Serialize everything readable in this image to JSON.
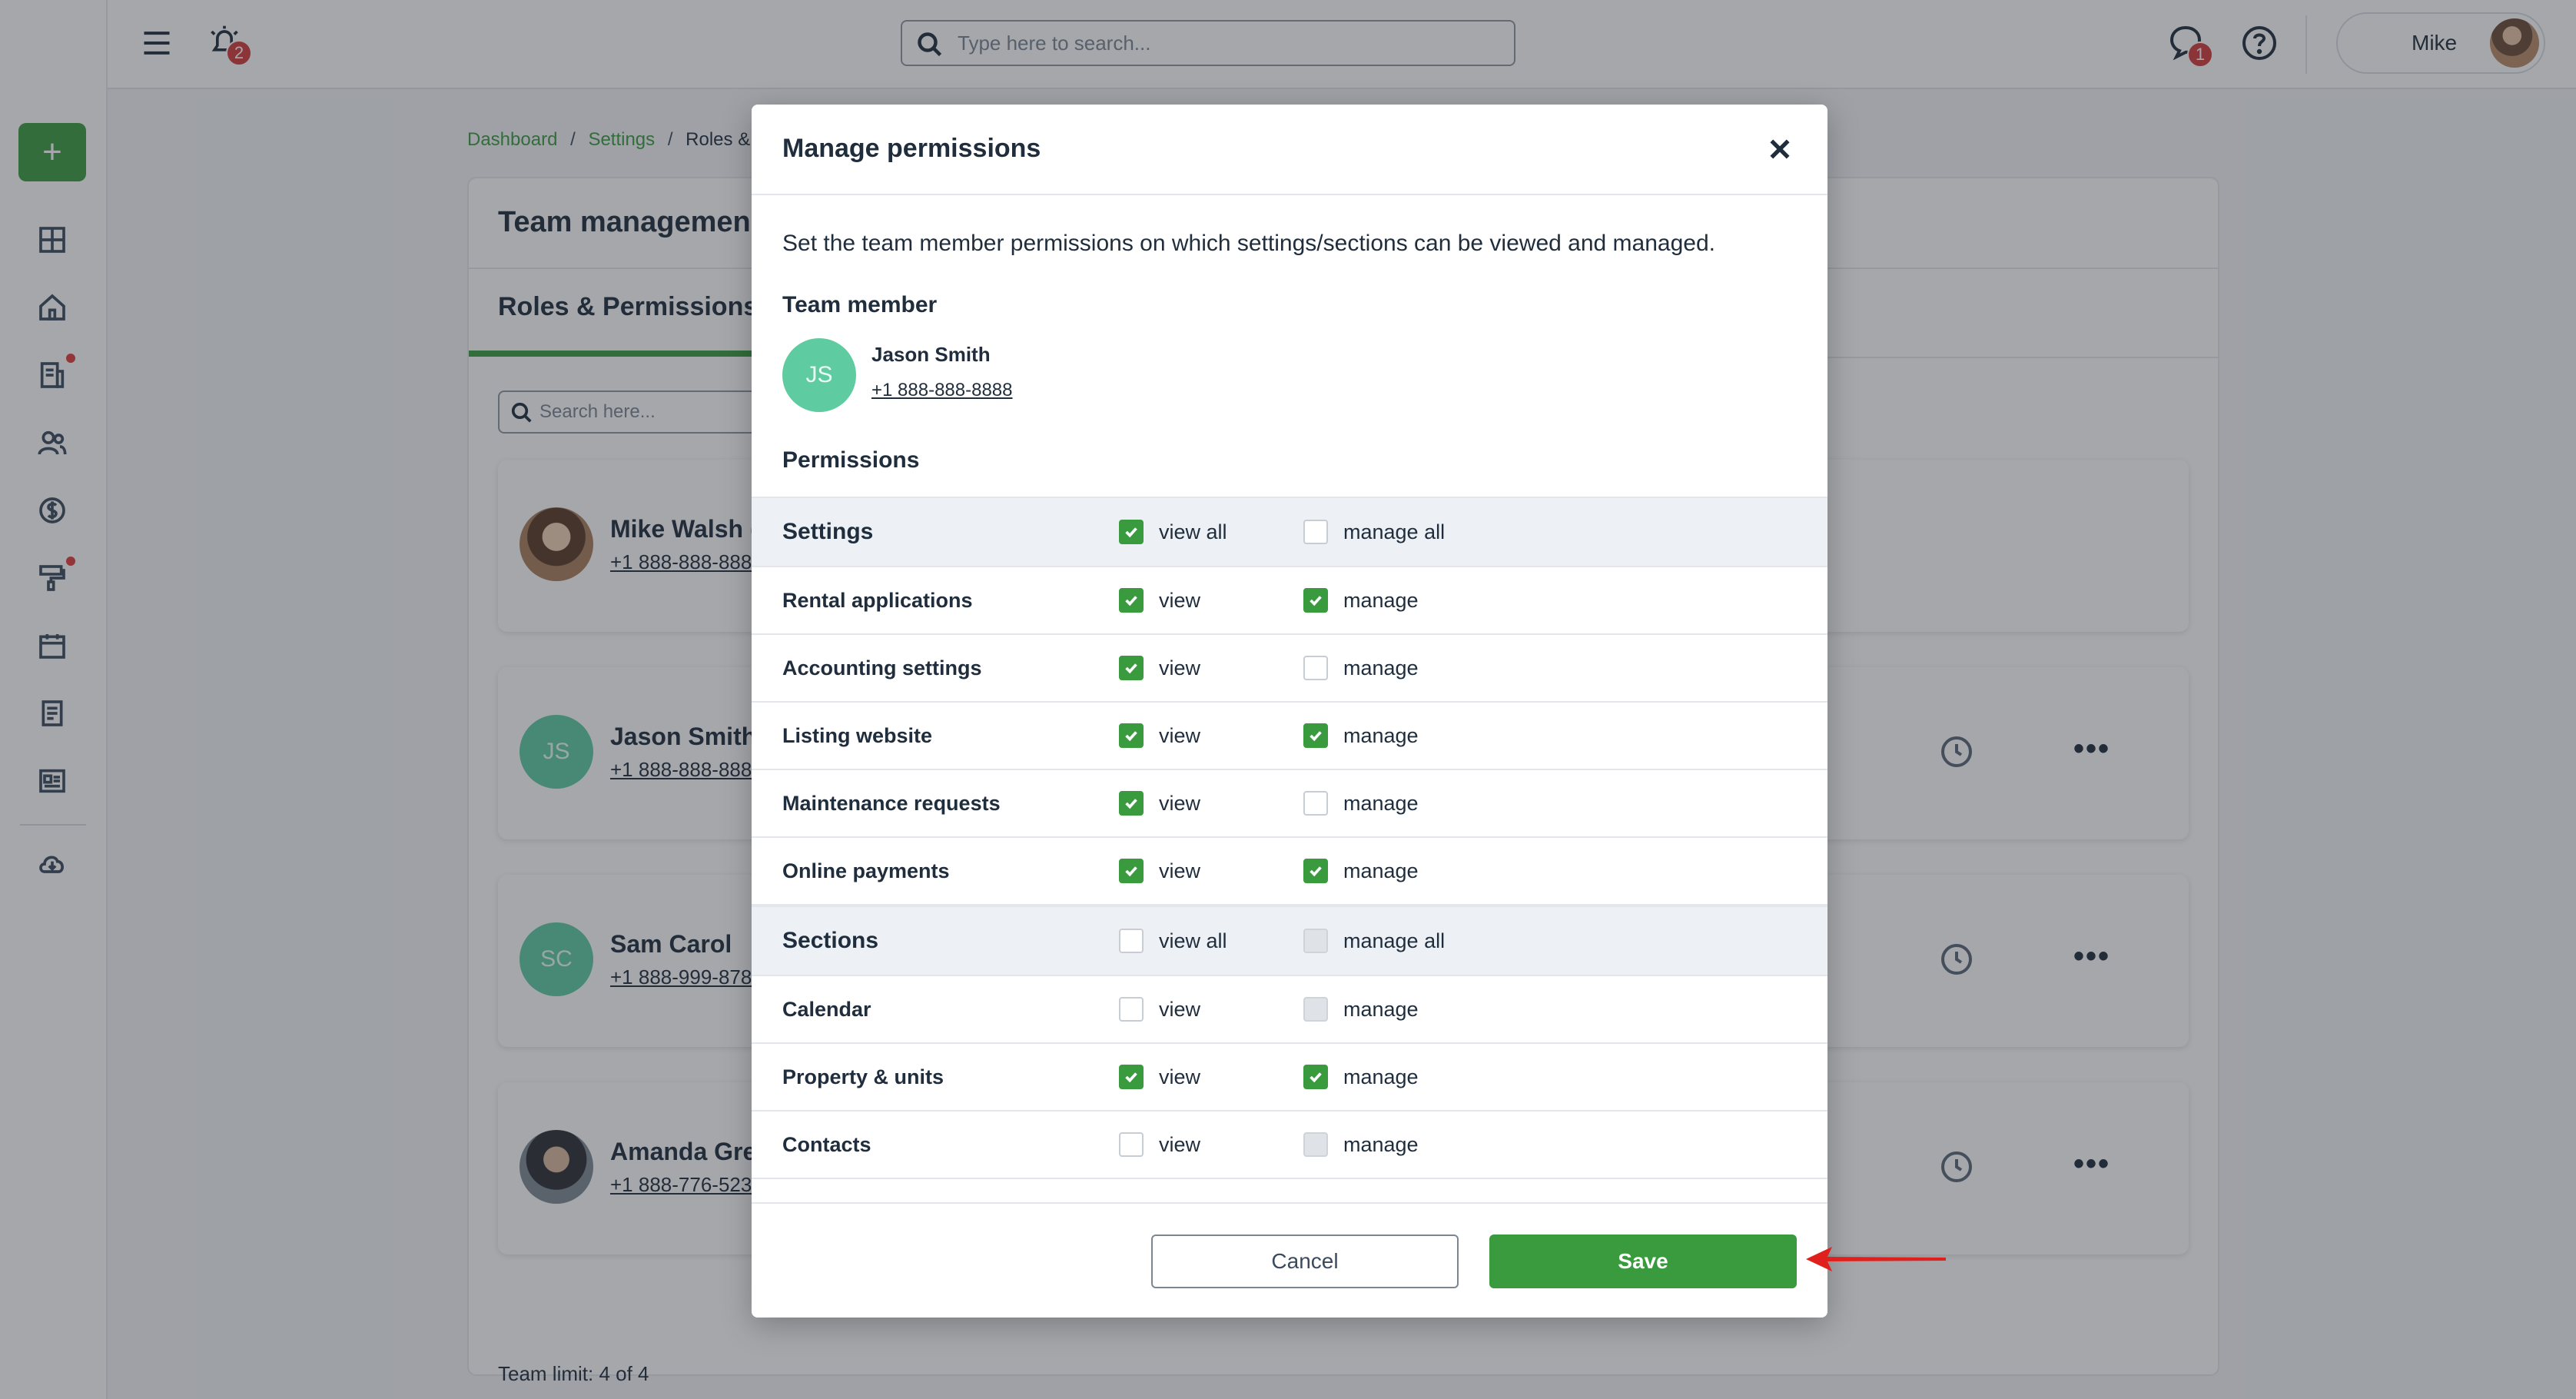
{
  "topbar": {
    "search_placeholder": "Type here to search...",
    "alarm_count": "2",
    "chat_count": "1",
    "user_name": "Mike"
  },
  "breadcrumb": {
    "items": [
      "Dashboard",
      "Settings",
      "Roles & P"
    ],
    "separator": "/"
  },
  "page": {
    "title": "Team managemen",
    "active_tab": "Roles & Permissions",
    "search_placeholder": "Search here...",
    "team_limit": "Team limit: 4 of 4",
    "members": [
      {
        "initials": "",
        "name": "Mike Walsh (",
        "phone": "+1 888-888-888"
      },
      {
        "initials": "JS",
        "name": "Jason Smith",
        "phone": "+1 888-888-888"
      },
      {
        "initials": "SC",
        "name": "Sam Carol",
        "phone": "+1 888-999-878"
      },
      {
        "initials": "",
        "name": "Amanda Gre",
        "phone": "+1 888-776-523"
      }
    ]
  },
  "modal": {
    "title": "Manage permissions",
    "description": "Set the team member permissions on which settings/sections can be viewed and managed.",
    "team_member_label": "Team member",
    "member": {
      "initials": "JS",
      "name": "Jason Smith",
      "phone": "+1 888-888-8888"
    },
    "permissions_label": "Permissions",
    "rows": [
      {
        "label": "Settings",
        "group": true,
        "view_label": "view all",
        "manage_label": "manage all",
        "view": "checked",
        "manage": "unchecked"
      },
      {
        "label": "Rental applications",
        "group": false,
        "view_label": "view",
        "manage_label": "manage",
        "view": "checked",
        "manage": "checked"
      },
      {
        "label": "Accounting settings",
        "group": false,
        "view_label": "view",
        "manage_label": "manage",
        "view": "checked",
        "manage": "unchecked"
      },
      {
        "label": "Listing website",
        "group": false,
        "view_label": "view",
        "manage_label": "manage",
        "view": "checked",
        "manage": "checked"
      },
      {
        "label": "Maintenance requests",
        "group": false,
        "view_label": "view",
        "manage_label": "manage",
        "view": "checked",
        "manage": "unchecked"
      },
      {
        "label": "Online payments",
        "group": false,
        "view_label": "view",
        "manage_label": "manage",
        "view": "checked",
        "manage": "checked"
      },
      {
        "label": "Sections",
        "group": true,
        "view_label": "view all",
        "manage_label": "manage all",
        "view": "unchecked",
        "manage": "disabled"
      },
      {
        "label": "Calendar",
        "group": false,
        "view_label": "view",
        "manage_label": "manage",
        "view": "unchecked",
        "manage": "disabled"
      },
      {
        "label": "Property & units",
        "group": false,
        "view_label": "view",
        "manage_label": "manage",
        "view": "checked",
        "manage": "checked"
      },
      {
        "label": "Contacts",
        "group": false,
        "view_label": "view",
        "manage_label": "manage",
        "view": "unchecked",
        "manage": "disabled"
      }
    ],
    "cancel_label": "Cancel",
    "save_label": "Save"
  },
  "colors": {
    "accent_green": "#3a9b3e",
    "badge_red": "#d23b3b",
    "avatar_teal": "#5ecba0",
    "arrow_red": "#e0201c"
  }
}
